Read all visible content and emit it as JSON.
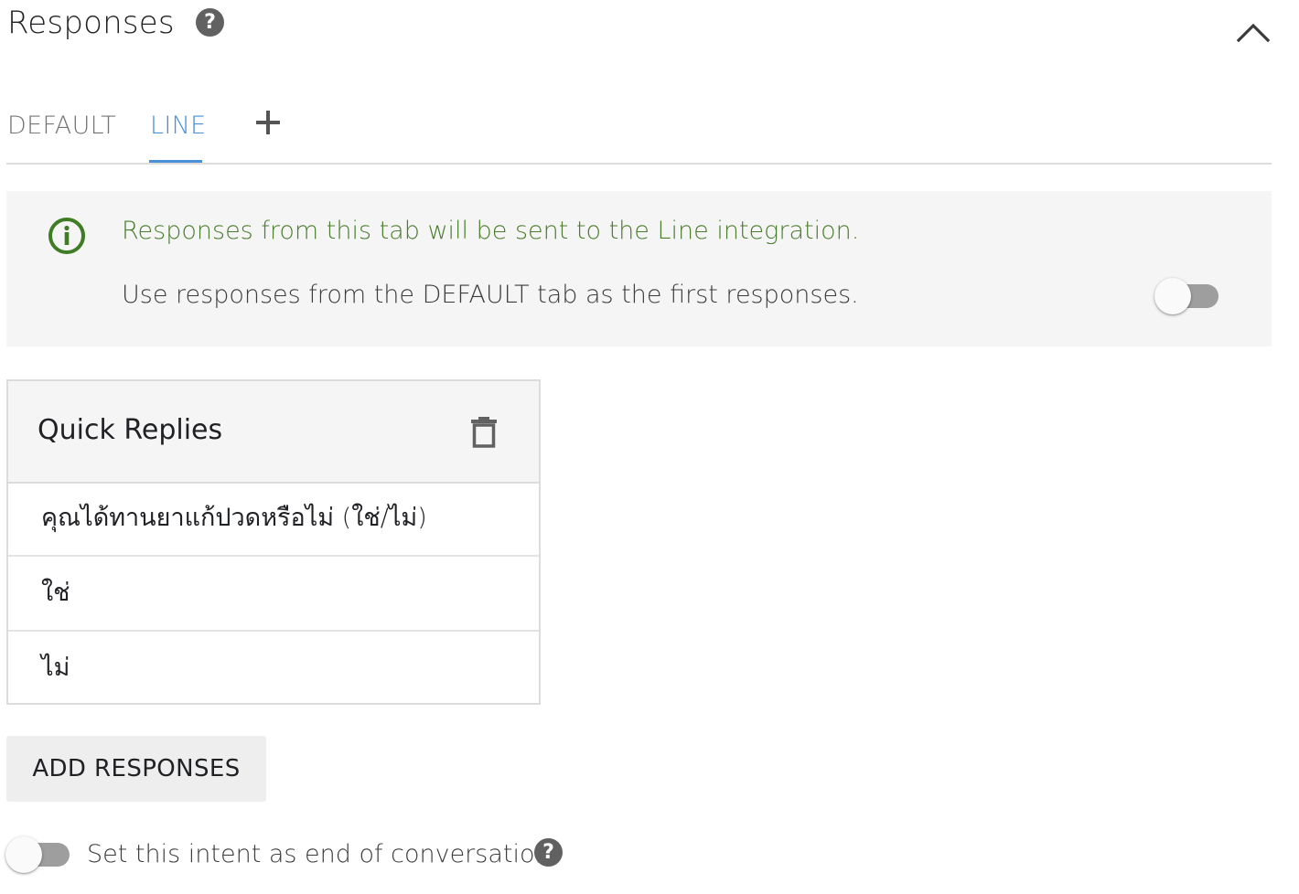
{
  "header": {
    "title": "Responses",
    "help_icon": "?",
    "collapse_icon": "chevron-up-icon"
  },
  "tabs": [
    {
      "label": "DEFAULT",
      "active": false
    },
    {
      "label": "LINE",
      "active": true
    }
  ],
  "tabs_add_icon": "plus-icon",
  "info_banner": {
    "icon": "info-icon",
    "message": "Responses from this tab will be sent to the Line integration.",
    "toggle_label": "Use responses from the DEFAULT tab as the first responses.",
    "toggle_on": false
  },
  "quick_replies": {
    "title": "Quick Replies",
    "delete_icon": "trash-icon",
    "items": [
      "คุณได้ทานยาแก้ปวดหรือไม่ (ใช่/ไม่)",
      "ใช่",
      "ไม่"
    ]
  },
  "add_responses_label": "ADD RESPONSES",
  "end_conversation": {
    "label": "Set this intent as end of conversation",
    "toggle_on": false,
    "help_icon": "?"
  },
  "colors": {
    "accent": "#4a90d9",
    "info_green": "#4a7d2d",
    "panel_bg": "#f5f5f5",
    "border": "#dcdcdc"
  }
}
